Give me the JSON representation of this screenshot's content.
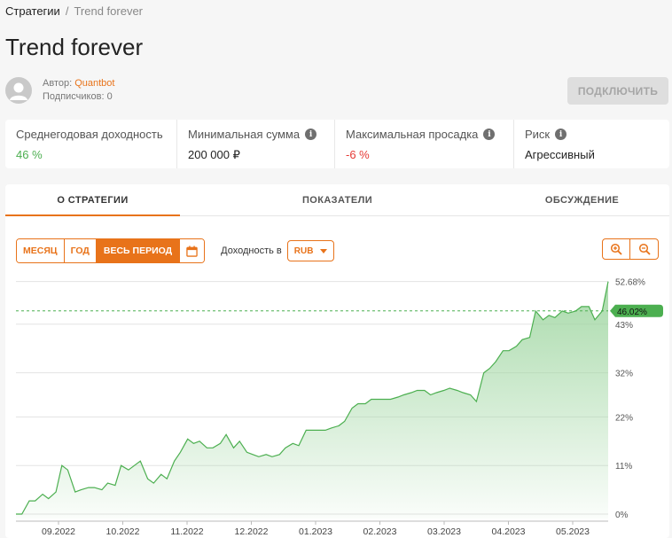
{
  "breadcrumb": {
    "parent": "Стратегии",
    "separator": "/",
    "current": "Trend forever"
  },
  "page": {
    "title": "Trend forever"
  },
  "author": {
    "label": "Автор:",
    "name": "Quantbot",
    "subscribers": "Подписчиков: 0"
  },
  "subscribe_button": "ПОДКЛЮЧИТЬ",
  "stats": [
    {
      "label": "Среднегодовая доходность",
      "value": "46 %",
      "info": false,
      "tone": "green"
    },
    {
      "label": "Минимальная сумма",
      "value": "200 000 ₽",
      "info": true,
      "tone": "normal"
    },
    {
      "label": "Максимальная просадка",
      "value": "-6 %",
      "info": true,
      "tone": "red"
    },
    {
      "label": "Риск",
      "value": "Агрессивный",
      "info": true,
      "tone": "normal"
    }
  ],
  "tabs": [
    "О СТРАТЕГИИ",
    "ПОКАЗАТЕЛИ",
    "ОБСУЖДЕНИЕ"
  ],
  "active_tab": 0,
  "periods": [
    "МЕСЯЦ",
    "ГОД",
    "ВЕСЬ ПЕРИОД"
  ],
  "active_period": 2,
  "yield_label": "Доходность в",
  "currency": "RUB",
  "colors": {
    "accent": "#e8731a",
    "line": "#4caf50",
    "fill": "#9fd6a1"
  },
  "icons": {
    "calendar": "calendar-icon",
    "zoom_in": "zoom-in-icon",
    "zoom_out": "zoom-out-icon",
    "info": "info-icon"
  },
  "chart_data": {
    "type": "area",
    "y_ticks": [
      "0%",
      "11%",
      "22%",
      "32%",
      "43%",
      "52.68%"
    ],
    "y_tick_values": [
      0,
      11,
      22,
      32,
      43,
      52.68
    ],
    "ylim": [
      -1,
      54
    ],
    "x_ticks": [
      "09.2022",
      "10.2022",
      "11.2022",
      "12.2022",
      "01.2023",
      "02.2023",
      "03.2023",
      "04.2023",
      "05.2023"
    ],
    "current_value": 46.02,
    "current_label": "46.02%",
    "grid": true,
    "series": [
      {
        "x": [
          0,
          0.4,
          0.9,
          1.3,
          1.8,
          2.2,
          2.7,
          3.1,
          3.5,
          4.0,
          4.4,
          4.9,
          5.3,
          5.8,
          6.2,
          6.7,
          7.1,
          7.6,
          8.0,
          8.4,
          8.9,
          9.3,
          9.8,
          10.2,
          10.7,
          11.1,
          11.6,
          12.0,
          12.4,
          12.9,
          13.3,
          13.8,
          14.2,
          14.7,
          15.1,
          15.6,
          16.0,
          16.4,
          16.9,
          17.3,
          17.8,
          18.2,
          18.7,
          19.1,
          19.6,
          20.0,
          20.4,
          20.9,
          21.3,
          21.8,
          22.2,
          22.7,
          23.1,
          23.6,
          24.0,
          24.4,
          24.9,
          25.3,
          25.8,
          26.2,
          26.7,
          27.1,
          27.6,
          28.0,
          28.4,
          28.9,
          29.3,
          29.8,
          30.2,
          30.7,
          31.1,
          31.6,
          32.0,
          32.4,
          32.9,
          33.3,
          33.8,
          34.2,
          34.7,
          35.1,
          35.6,
          36.0,
          36.4,
          36.9,
          37.3,
          37.8,
          38.2,
          38.7,
          39.1,
          39.6,
          40.0
        ],
        "y": [
          0,
          0,
          3,
          3,
          4.5,
          3.5,
          5,
          11,
          10,
          5,
          5.5,
          6,
          6,
          5.5,
          7,
          6.5,
          11,
          10,
          11,
          12,
          8,
          7,
          9,
          8,
          12,
          14,
          17,
          16,
          16.5,
          15,
          15,
          16,
          18,
          15,
          16.5,
          14,
          13.5,
          13,
          13.5,
          13,
          13.5,
          15,
          16,
          15.5,
          19,
          19,
          19,
          19,
          19.5,
          20,
          21,
          24,
          25,
          25,
          26,
          26,
          26,
          26,
          26.5,
          27,
          27.5,
          28,
          28,
          27,
          27.5,
          28,
          28.5,
          28,
          27.5,
          27,
          25.5,
          32,
          33,
          34.5,
          37,
          37,
          38,
          39.5,
          40,
          46,
          44,
          45,
          44.5,
          46,
          45.5,
          46,
          47,
          47,
          44,
          46,
          52.68
        ]
      }
    ]
  }
}
